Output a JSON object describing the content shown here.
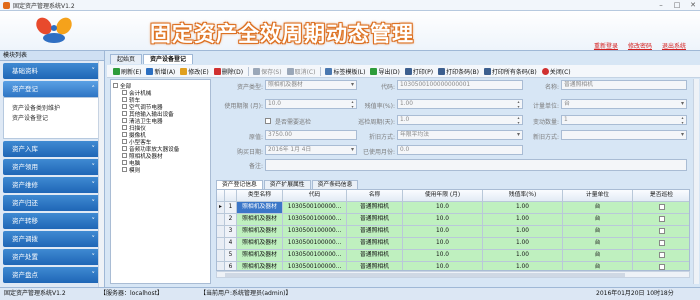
{
  "window": {
    "title": "固定资产管理系统V1.2"
  },
  "banner": {
    "title": "固定资产全效周期动态管理",
    "links": [
      "重新登录",
      "修改密码",
      "退出系统"
    ]
  },
  "sidebar": {
    "header": "模块列表",
    "items": [
      {
        "label": "基础资料"
      },
      {
        "label": "资产登记",
        "sub": [
          "资产设备类别维护",
          "资产设备登记"
        ]
      },
      {
        "label": "资产入库"
      },
      {
        "label": "资产领用"
      },
      {
        "label": "资产维修"
      },
      {
        "label": "资产归还"
      },
      {
        "label": "资产转移"
      },
      {
        "label": "资产调拨"
      },
      {
        "label": "资产处置"
      },
      {
        "label": "资产盘点"
      }
    ]
  },
  "tabs": [
    {
      "label": "起始页"
    },
    {
      "label": "资产设备登记"
    }
  ],
  "toolbar": {
    "buttons": [
      {
        "label": "刷新(E)",
        "color": "#2e9c3a",
        "enabled": true
      },
      {
        "label": "新增(A)",
        "color": "#2c6fc1",
        "enabled": true
      },
      {
        "label": "修改(E)",
        "color": "#e0a020",
        "enabled": true
      },
      {
        "label": "删除(D)",
        "color": "#d03030",
        "enabled": true
      },
      {
        "label": "保存(S)",
        "color": "#9aa7b8",
        "enabled": false
      },
      {
        "label": "取消(C)",
        "color": "#9aa7b8",
        "enabled": false
      },
      {
        "label": "标签模板(L)",
        "color": "#4a78b0",
        "enabled": true
      },
      {
        "label": "导出(D)",
        "color": "#2e9c3a",
        "enabled": true
      },
      {
        "label": "打印(P)",
        "color": "#3c5f8f",
        "enabled": true
      },
      {
        "label": "打印条码(B)",
        "color": "#3c5f8f",
        "enabled": true
      },
      {
        "label": "打印所有条码(B)",
        "color": "#3c5f8f",
        "enabled": true
      },
      {
        "label": "关闭(C)",
        "color": "#d03030",
        "enabled": true
      }
    ]
  },
  "tree": {
    "root": "全部",
    "items": [
      "会计机械",
      "轿车",
      "空气调节电器",
      "其他输入输出设备",
      "清洁卫生电器",
      "扫描仪",
      "摄像机",
      "小型客车",
      "音频功率放大器设备",
      "照相机及器材",
      "电脑",
      "模则"
    ]
  },
  "form": {
    "asset_type_label": "资产类型:",
    "asset_type_value": "照相机及器材",
    "code_label": "代码:",
    "code_value": "1030500100000000001",
    "name_label": "名称:",
    "name_value": "普通照相机",
    "use_years_label": "使用期限 (月):",
    "use_years_value": "10.0",
    "salvage_label": "残值率(%):",
    "salvage_value": "1.00",
    "unit_label": "计量单位:",
    "unit_value": "台",
    "inspect_label": "是否需要巡检",
    "cycle_label": "巡检周期(天):",
    "cycle_value": "1.0",
    "count_label": "变动数量:",
    "count_value": "1",
    "price_label": "原值:",
    "price_value": "3750.00",
    "method_label": "折旧方式:",
    "method_value": "年限平均法",
    "new_label": "新旧方式:",
    "new_value": "",
    "date_label": "购买日期:",
    "date_value": "2016年 1月 4日",
    "used_label": "已使用月份:",
    "used_value": "0.0",
    "note_label": "备注:",
    "note_value": ""
  },
  "grid_tabs": [
    "资产登记信息",
    "资产扩展属性",
    "资产条码信息"
  ],
  "grid": {
    "columns": [
      "类型名称",
      "代码",
      "名称",
      "使用年限 (月)",
      "残值率(%)",
      "计量单位",
      "是否巡检"
    ],
    "rows": [
      [
        "照相机及器材",
        "1030500100000...",
        "普通照相机",
        "10.0",
        "1.00",
        "台",
        false
      ],
      [
        "照相机及器材",
        "1030500100000...",
        "普通照相机",
        "10.0",
        "1.00",
        "台",
        false
      ],
      [
        "照相机及器材",
        "1030500100000...",
        "普通照相机",
        "10.0",
        "1.00",
        "台",
        false
      ],
      [
        "照相机及器材",
        "1030500100000...",
        "普通照相机",
        "10.0",
        "1.00",
        "台",
        false
      ],
      [
        "照相机及器材",
        "1030500100000...",
        "普通照相机",
        "10.0",
        "1.00",
        "台",
        false
      ],
      [
        "照相机及器材",
        "1030500100000...",
        "普通照相机",
        "10.0",
        "1.00",
        "台",
        false
      ]
    ]
  },
  "status": {
    "app": "固定资产管理系统V1.2",
    "server": "【服务器：localhost】",
    "user": "【当前用户:系统管理员(admin)】",
    "datetime": "2016年01月20日 10时18分"
  }
}
